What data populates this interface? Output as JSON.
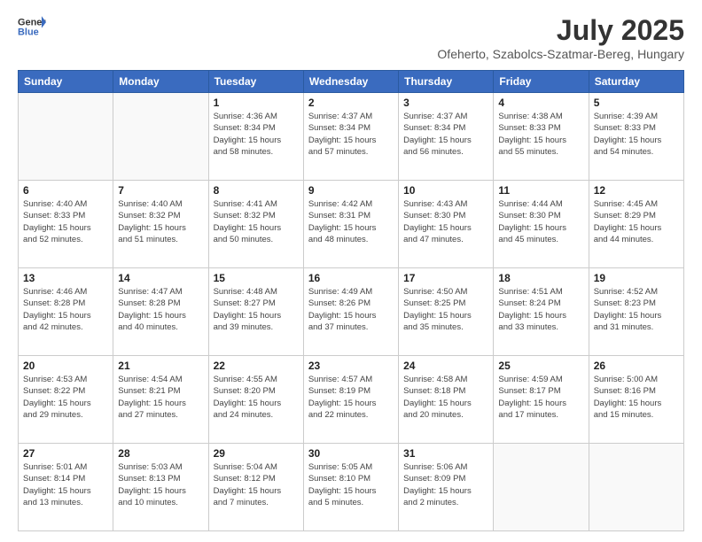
{
  "header": {
    "logo_line1": "General",
    "logo_line2": "Blue",
    "title": "July 2025",
    "location": "Ofeherto, Szabolcs-Szatmar-Bereg, Hungary"
  },
  "days_of_week": [
    "Sunday",
    "Monday",
    "Tuesday",
    "Wednesday",
    "Thursday",
    "Friday",
    "Saturday"
  ],
  "weeks": [
    [
      {
        "day": "",
        "details": ""
      },
      {
        "day": "",
        "details": ""
      },
      {
        "day": "1",
        "details": "Sunrise: 4:36 AM\nSunset: 8:34 PM\nDaylight: 15 hours\nand 58 minutes."
      },
      {
        "day": "2",
        "details": "Sunrise: 4:37 AM\nSunset: 8:34 PM\nDaylight: 15 hours\nand 57 minutes."
      },
      {
        "day": "3",
        "details": "Sunrise: 4:37 AM\nSunset: 8:34 PM\nDaylight: 15 hours\nand 56 minutes."
      },
      {
        "day": "4",
        "details": "Sunrise: 4:38 AM\nSunset: 8:33 PM\nDaylight: 15 hours\nand 55 minutes."
      },
      {
        "day": "5",
        "details": "Sunrise: 4:39 AM\nSunset: 8:33 PM\nDaylight: 15 hours\nand 54 minutes."
      }
    ],
    [
      {
        "day": "6",
        "details": "Sunrise: 4:40 AM\nSunset: 8:33 PM\nDaylight: 15 hours\nand 52 minutes."
      },
      {
        "day": "7",
        "details": "Sunrise: 4:40 AM\nSunset: 8:32 PM\nDaylight: 15 hours\nand 51 minutes."
      },
      {
        "day": "8",
        "details": "Sunrise: 4:41 AM\nSunset: 8:32 PM\nDaylight: 15 hours\nand 50 minutes."
      },
      {
        "day": "9",
        "details": "Sunrise: 4:42 AM\nSunset: 8:31 PM\nDaylight: 15 hours\nand 48 minutes."
      },
      {
        "day": "10",
        "details": "Sunrise: 4:43 AM\nSunset: 8:30 PM\nDaylight: 15 hours\nand 47 minutes."
      },
      {
        "day": "11",
        "details": "Sunrise: 4:44 AM\nSunset: 8:30 PM\nDaylight: 15 hours\nand 45 minutes."
      },
      {
        "day": "12",
        "details": "Sunrise: 4:45 AM\nSunset: 8:29 PM\nDaylight: 15 hours\nand 44 minutes."
      }
    ],
    [
      {
        "day": "13",
        "details": "Sunrise: 4:46 AM\nSunset: 8:28 PM\nDaylight: 15 hours\nand 42 minutes."
      },
      {
        "day": "14",
        "details": "Sunrise: 4:47 AM\nSunset: 8:28 PM\nDaylight: 15 hours\nand 40 minutes."
      },
      {
        "day": "15",
        "details": "Sunrise: 4:48 AM\nSunset: 8:27 PM\nDaylight: 15 hours\nand 39 minutes."
      },
      {
        "day": "16",
        "details": "Sunrise: 4:49 AM\nSunset: 8:26 PM\nDaylight: 15 hours\nand 37 minutes."
      },
      {
        "day": "17",
        "details": "Sunrise: 4:50 AM\nSunset: 8:25 PM\nDaylight: 15 hours\nand 35 minutes."
      },
      {
        "day": "18",
        "details": "Sunrise: 4:51 AM\nSunset: 8:24 PM\nDaylight: 15 hours\nand 33 minutes."
      },
      {
        "day": "19",
        "details": "Sunrise: 4:52 AM\nSunset: 8:23 PM\nDaylight: 15 hours\nand 31 minutes."
      }
    ],
    [
      {
        "day": "20",
        "details": "Sunrise: 4:53 AM\nSunset: 8:22 PM\nDaylight: 15 hours\nand 29 minutes."
      },
      {
        "day": "21",
        "details": "Sunrise: 4:54 AM\nSunset: 8:21 PM\nDaylight: 15 hours\nand 27 minutes."
      },
      {
        "day": "22",
        "details": "Sunrise: 4:55 AM\nSunset: 8:20 PM\nDaylight: 15 hours\nand 24 minutes."
      },
      {
        "day": "23",
        "details": "Sunrise: 4:57 AM\nSunset: 8:19 PM\nDaylight: 15 hours\nand 22 minutes."
      },
      {
        "day": "24",
        "details": "Sunrise: 4:58 AM\nSunset: 8:18 PM\nDaylight: 15 hours\nand 20 minutes."
      },
      {
        "day": "25",
        "details": "Sunrise: 4:59 AM\nSunset: 8:17 PM\nDaylight: 15 hours\nand 17 minutes."
      },
      {
        "day": "26",
        "details": "Sunrise: 5:00 AM\nSunset: 8:16 PM\nDaylight: 15 hours\nand 15 minutes."
      }
    ],
    [
      {
        "day": "27",
        "details": "Sunrise: 5:01 AM\nSunset: 8:14 PM\nDaylight: 15 hours\nand 13 minutes."
      },
      {
        "day": "28",
        "details": "Sunrise: 5:03 AM\nSunset: 8:13 PM\nDaylight: 15 hours\nand 10 minutes."
      },
      {
        "day": "29",
        "details": "Sunrise: 5:04 AM\nSunset: 8:12 PM\nDaylight: 15 hours\nand 7 minutes."
      },
      {
        "day": "30",
        "details": "Sunrise: 5:05 AM\nSunset: 8:10 PM\nDaylight: 15 hours\nand 5 minutes."
      },
      {
        "day": "31",
        "details": "Sunrise: 5:06 AM\nSunset: 8:09 PM\nDaylight: 15 hours\nand 2 minutes."
      },
      {
        "day": "",
        "details": ""
      },
      {
        "day": "",
        "details": ""
      }
    ]
  ]
}
